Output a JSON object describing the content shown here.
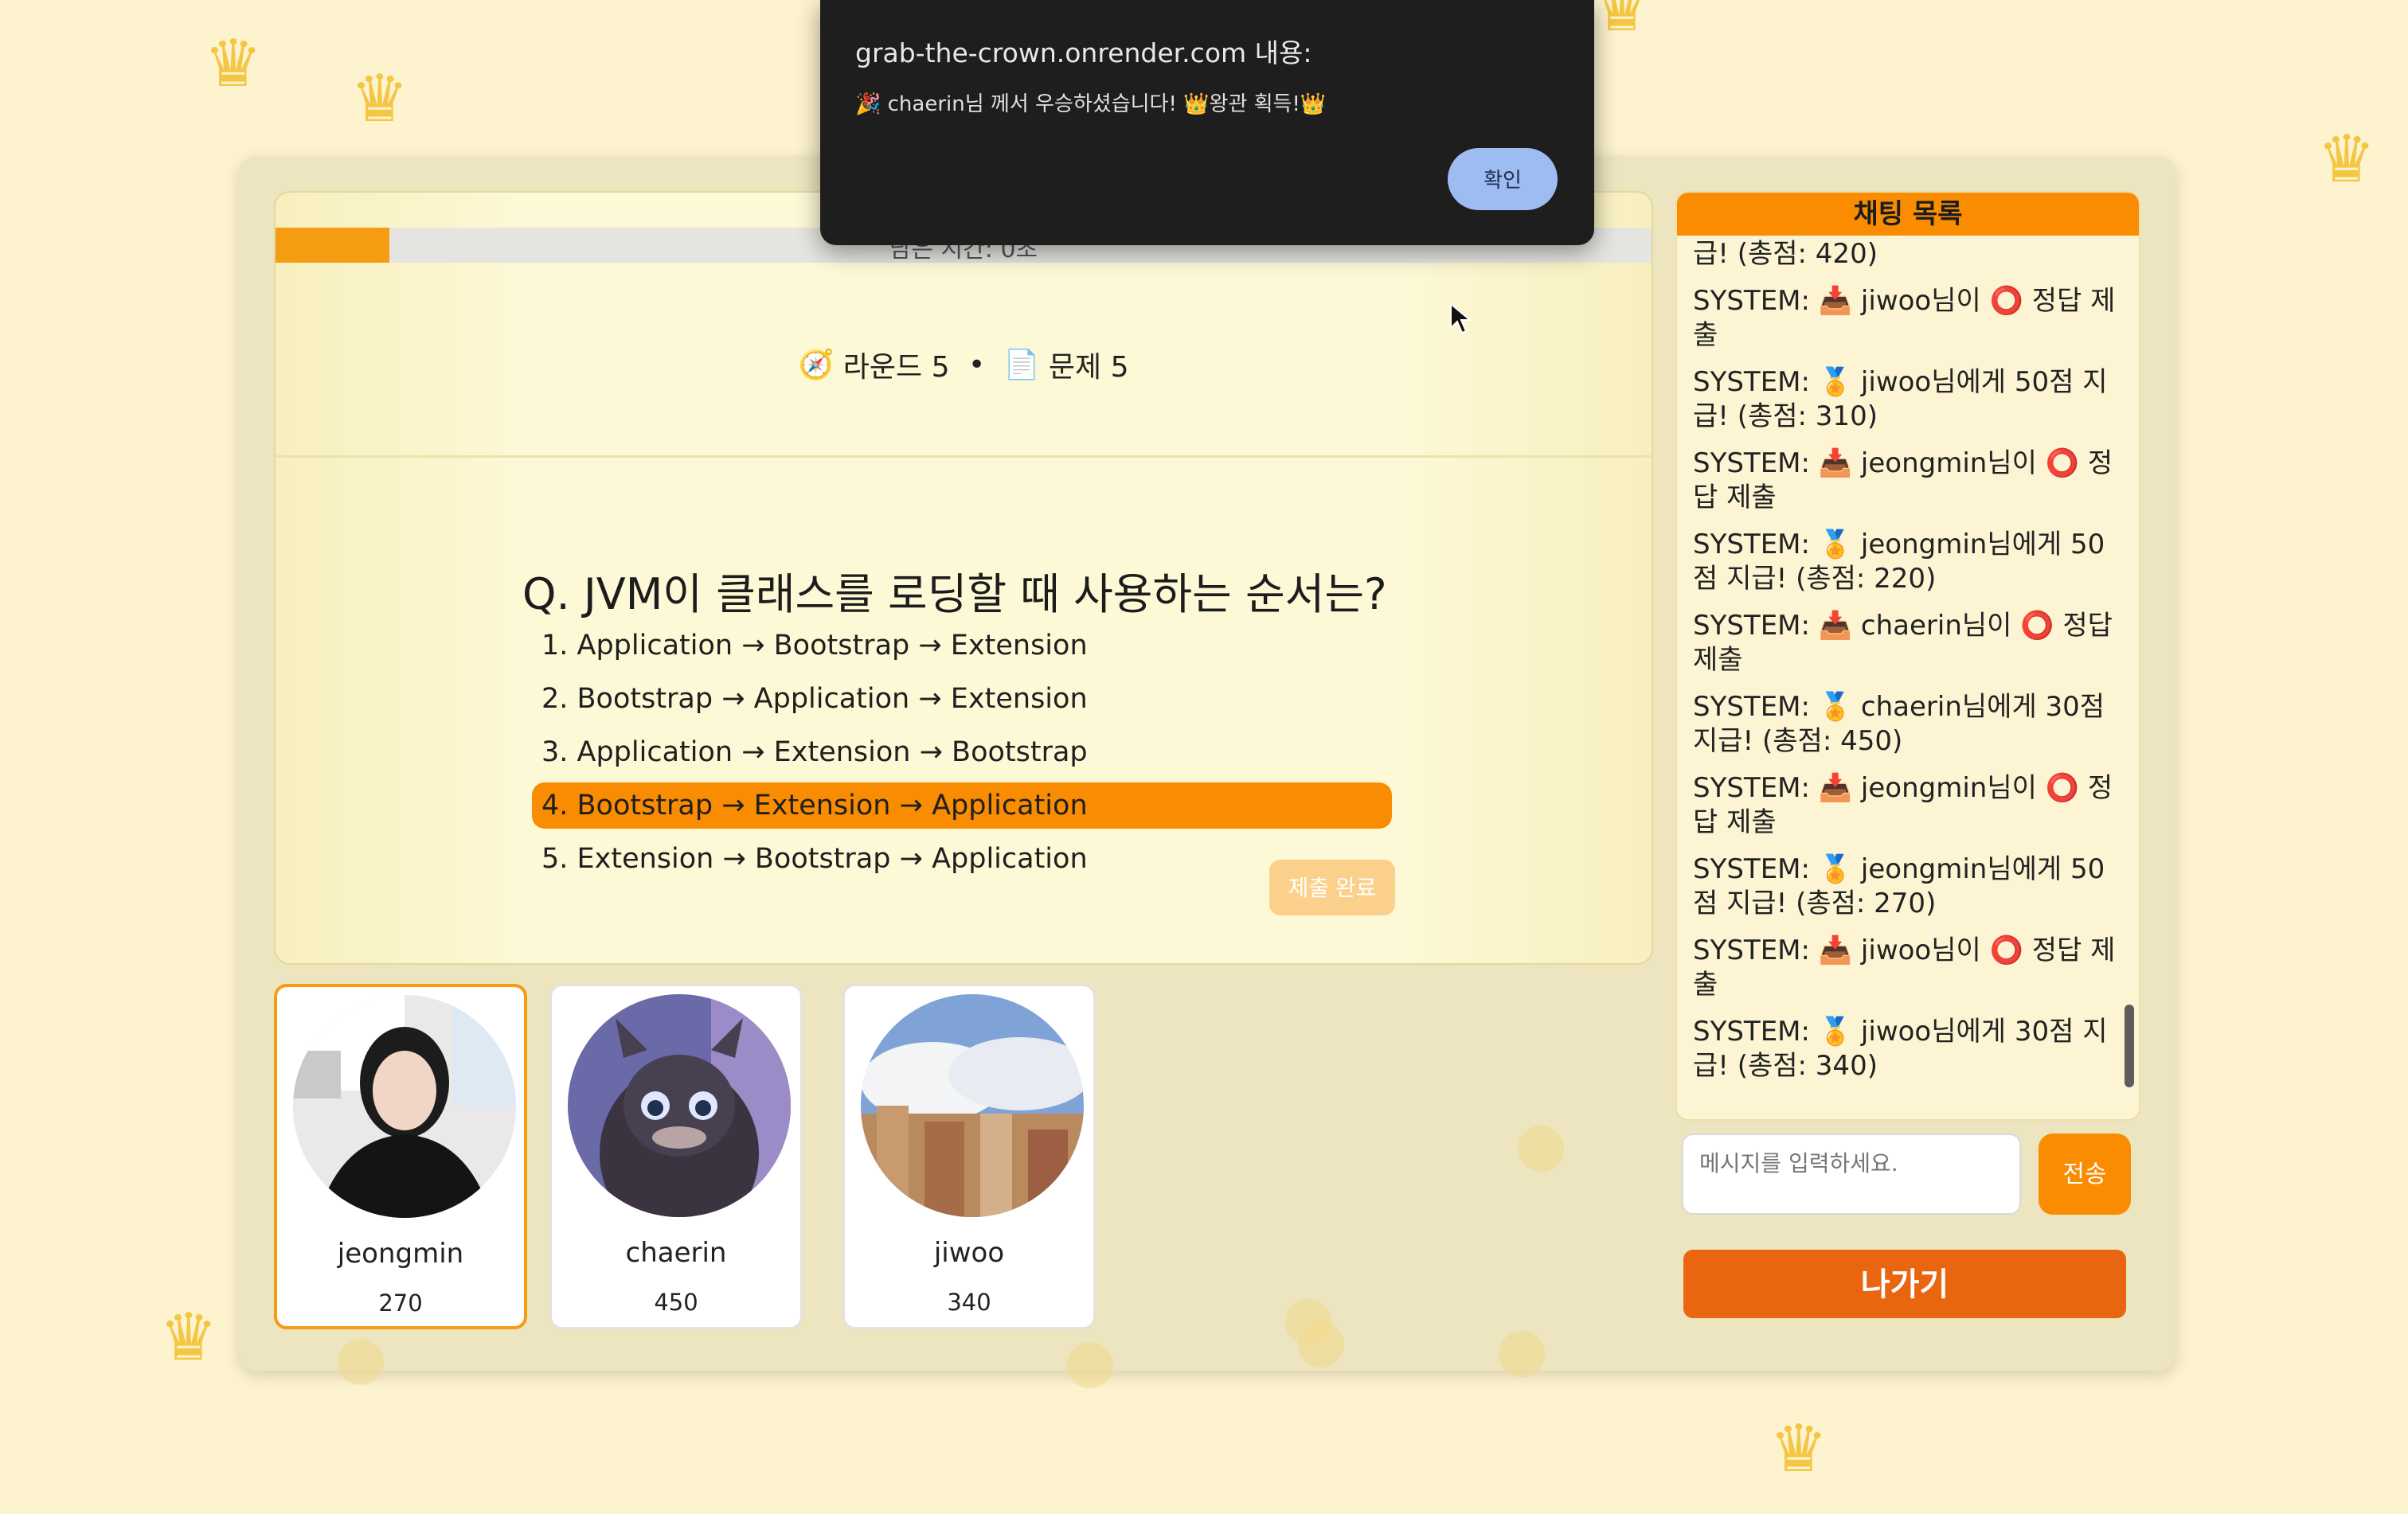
{
  "alert": {
    "title": "grab-the-crown.onrender.com 내용:",
    "message": "🎉 chaerin님 께서 우승하셨습니다! 👑왕관 획득!👑",
    "ok_label": "확인"
  },
  "quiz": {
    "timer_text": "남은 시간: 0초",
    "timer_progress": 0.083,
    "round_icon": "🧭",
    "round_label": "라운드 5",
    "separator": "•",
    "problem_icon": "📄",
    "problem_label": "문제 5",
    "question": "Q. JVM이 클래스를 로딩할 때 사용하는 순서는?",
    "options": [
      "1. Application → Bootstrap → Extension",
      "2. Bootstrap → Application → Extension",
      "3. Application → Extension → Bootstrap",
      "4. Bootstrap → Extension → Application",
      "5. Extension → Bootstrap → Application"
    ],
    "selected_index": 3,
    "submit_label": "제출 완료"
  },
  "players": [
    {
      "name": "jeongmin",
      "score": "270",
      "active": true
    },
    {
      "name": "chaerin",
      "score": "450",
      "active": false
    },
    {
      "name": "jiwoo",
      "score": "340",
      "active": false
    }
  ],
  "chat": {
    "header": "채팅 목록",
    "messages": [
      "급! (총점: 420)",
      "SYSTEM: 📥 jiwoo님이 ⭕ 정답 제출",
      "SYSTEM: 🏅 jiwoo님에게 50점 지급! (총점: 310)",
      "SYSTEM: 📥 jeongmin님이 ⭕ 정답 제출",
      "SYSTEM: 🏅 jeongmin님에게 50점 지급! (총점: 220)",
      "SYSTEM: 📥 chaerin님이 ⭕ 정답 제출",
      "SYSTEM: 🏅 chaerin님에게 30점 지급! (총점: 450)",
      "SYSTEM: 📥 jeongmin님이 ⭕ 정답 제출",
      "SYSTEM: 🏅 jeongmin님에게 50점 지급! (총점: 270)",
      "SYSTEM: 📥 jiwoo님이 ⭕ 정답 제출",
      "SYSTEM: 🏅 jiwoo님에게 30점 지급! (총점: 340)"
    ],
    "input_placeholder": "메시지를 입력하세요.",
    "send_label": "전송"
  },
  "exit_label": "나가기",
  "colors": {
    "accent": "#f98c00",
    "exit": "#ea6510",
    "background": "#fdf3cf",
    "panel": "#ece5bf"
  }
}
